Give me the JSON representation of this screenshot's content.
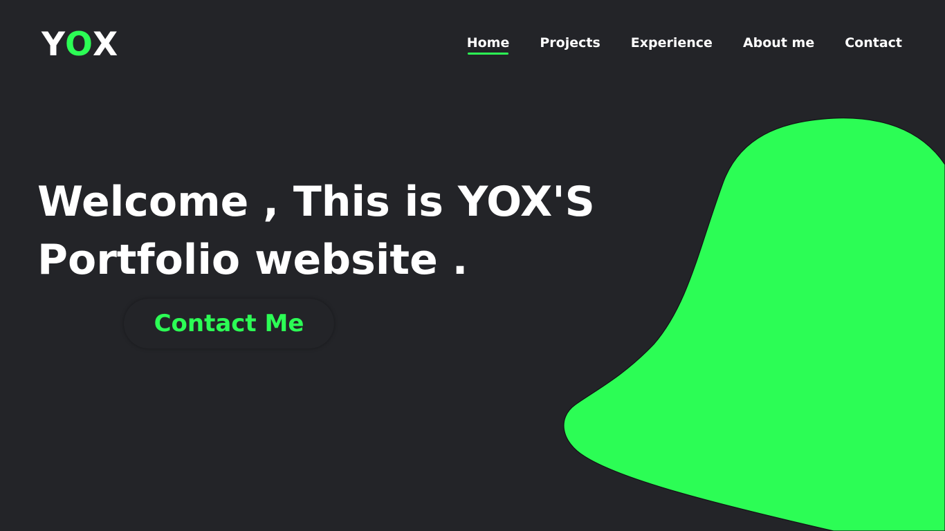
{
  "brand": {
    "logo": [
      "Y",
      "O",
      "X"
    ]
  },
  "nav": {
    "items": [
      {
        "label": "Home",
        "active": true
      },
      {
        "label": "Projects",
        "active": false
      },
      {
        "label": "Experience",
        "active": false
      },
      {
        "label": "About me",
        "active": false
      },
      {
        "label": "Contact",
        "active": false
      }
    ]
  },
  "hero": {
    "title_line1": "Welcome , This is YOX'S",
    "title_line2": "Portfolio website .",
    "cta_label": "Contact Me"
  },
  "colors": {
    "background": "#232428",
    "accent": "#2CFD55",
    "text": "#FFFFFF"
  }
}
